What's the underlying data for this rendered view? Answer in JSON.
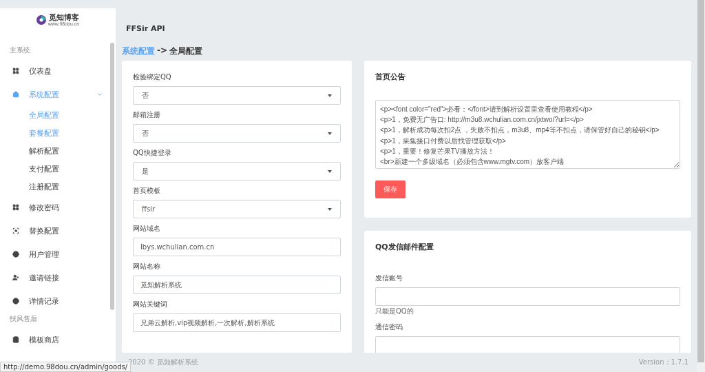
{
  "logo": {
    "title": "觅知博客",
    "subtitle": "www.98dou.cn"
  },
  "header": {
    "title": "FFSir API"
  },
  "sidebar": {
    "sections": [
      {
        "label": "主系统",
        "items": [
          {
            "label": "仪表盘",
            "selected": false
          },
          {
            "label": "系统配置",
            "selected": true,
            "expanded": true,
            "children": [
              {
                "label": "全局配置",
                "selected": true
              },
              {
                "label": "套餐配置",
                "selected": true
              },
              {
                "label": "解析配置",
                "selected": false
              },
              {
                "label": "支付配置",
                "selected": false
              },
              {
                "label": "注册配置",
                "selected": false
              }
            ]
          },
          {
            "label": "修改密码",
            "selected": false
          },
          {
            "label": "替换配置",
            "selected": false
          },
          {
            "label": "用户管理",
            "selected": false
          },
          {
            "label": "邀请链接",
            "selected": false
          },
          {
            "label": "详情记录",
            "selected": false
          }
        ]
      },
      {
        "label": "扶风售后",
        "items": [
          {
            "label": "模板商店",
            "selected": false
          }
        ]
      }
    ]
  },
  "breadcrumb": {
    "parent": "系统配置",
    "separator": "->",
    "current": "全局配置"
  },
  "global_form": {
    "fields": [
      {
        "kind": "select",
        "label": "检验绑定QQ",
        "value": "否"
      },
      {
        "kind": "select",
        "label": "邮箱注册",
        "value": "否"
      },
      {
        "kind": "select",
        "label": "QQ快捷登录",
        "value": "是"
      },
      {
        "kind": "select",
        "label": "首页模板",
        "value": "ffsir"
      },
      {
        "kind": "input",
        "label": "网站域名",
        "value": "lbys.wchulian.com.cn"
      },
      {
        "kind": "input",
        "label": "网站名称",
        "value": "觅知解析系统"
      },
      {
        "kind": "input",
        "label": "网站关键词",
        "value": "兄弟云解析,vip视频解析,一次解析,解析系统"
      }
    ]
  },
  "notice_card": {
    "title": "首页公告",
    "lines": [
      "<p><font color=\"red\">必看：</font>请到解析设置里查看使用教程</p>",
      "<p>1，免费无广告口: http://m3u8.wchulian.com.cn/jxtwo/?url=</p>",
      "<p>1，解析成功每次扣2点 ，失败不扣点，m3u8、mp4等不扣点，请保管好自己的秘钥</p>",
      "<p>1，采集接口付费以后找管理获取</p>",
      "<p>1，重要！修复芒果TV播放方法！",
      "<br>新建一个多级域名（必须包含www.mgtv.com）放客户端"
    ],
    "button": "保存"
  },
  "mail_card": {
    "title": "QQ发信邮件配置",
    "fields": [
      {
        "label": "发信账号",
        "help": "只能是QQ的"
      },
      {
        "label": "通信密码"
      }
    ]
  },
  "footer": {
    "copyright": "2020 © 觅知解析系统",
    "version": "Version：1.7.1"
  },
  "status_bar": {
    "url": "http://demo.98dou.cn/admin/goods/"
  }
}
